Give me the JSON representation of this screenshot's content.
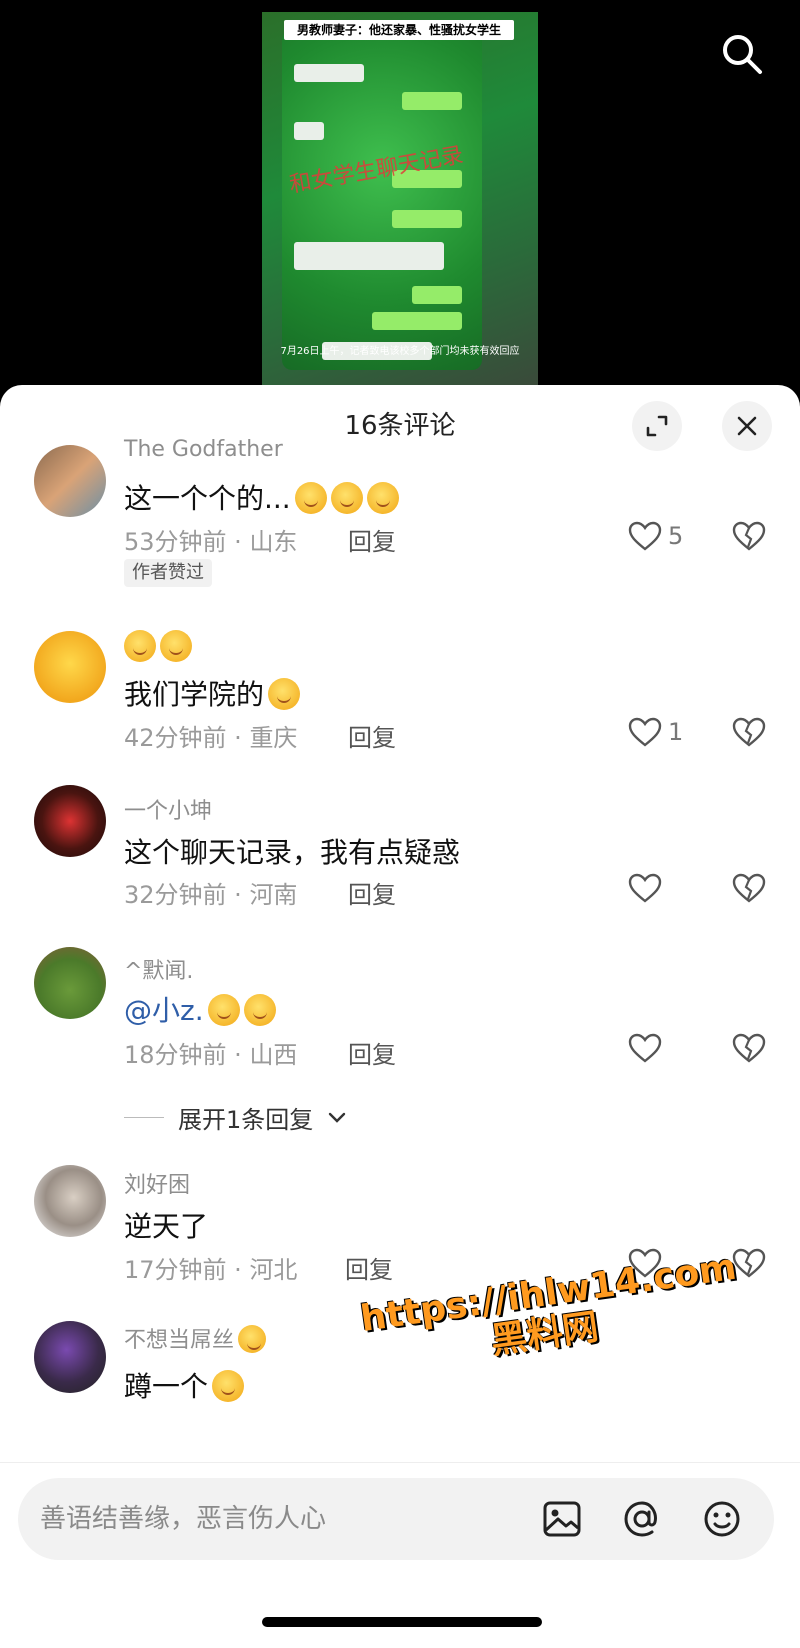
{
  "video": {
    "caption": "男教师妻子：他还家暴、性骚扰女学生",
    "overlay": "和女学生聊天记录",
    "subtitle": "7月26日上午，记者致电该校多个部门均未获有效回应"
  },
  "sheet": {
    "title": "16条评论"
  },
  "comments": [
    {
      "user": "The Godfather",
      "text": "这一个个的...",
      "emoji_count": 3,
      "time": "53分钟前",
      "region": "山东",
      "reply_label": "回复",
      "likes": "5",
      "author_badge": "作者赞过"
    },
    {
      "user": "",
      "top_emojis": 2,
      "text": "我们学院的",
      "emoji_count": 1,
      "time": "42分钟前",
      "region": "重庆",
      "reply_label": "回复",
      "likes": "1"
    },
    {
      "user": "一个小坤",
      "text": "这个聊天记录，我有点疑惑",
      "time": "32分钟前",
      "region": "河南",
      "reply_label": "回复",
      "likes": ""
    },
    {
      "user": "^默闻.",
      "mention": "@小z.",
      "emoji_count": 2,
      "time": "18分钟前",
      "region": "山西",
      "reply_label": "回复",
      "likes": ""
    },
    {
      "user": "刘好困",
      "text": "逆天了",
      "time": "17分钟前",
      "region": "河北",
      "reply_label": "回复",
      "likes": ""
    },
    {
      "user": "不想当屌丝",
      "text": "蹲一个",
      "emoji_count": 1
    }
  ],
  "expand_replies": "展开1条回复",
  "watermark": {
    "line1": "https://ihlw14.com",
    "line2": "黑料网"
  },
  "input": {
    "placeholder": "善语结善缘，恶言伤人心"
  },
  "colors": {
    "mention": "#2f5ea8",
    "watermark": "#ff9a1f"
  }
}
